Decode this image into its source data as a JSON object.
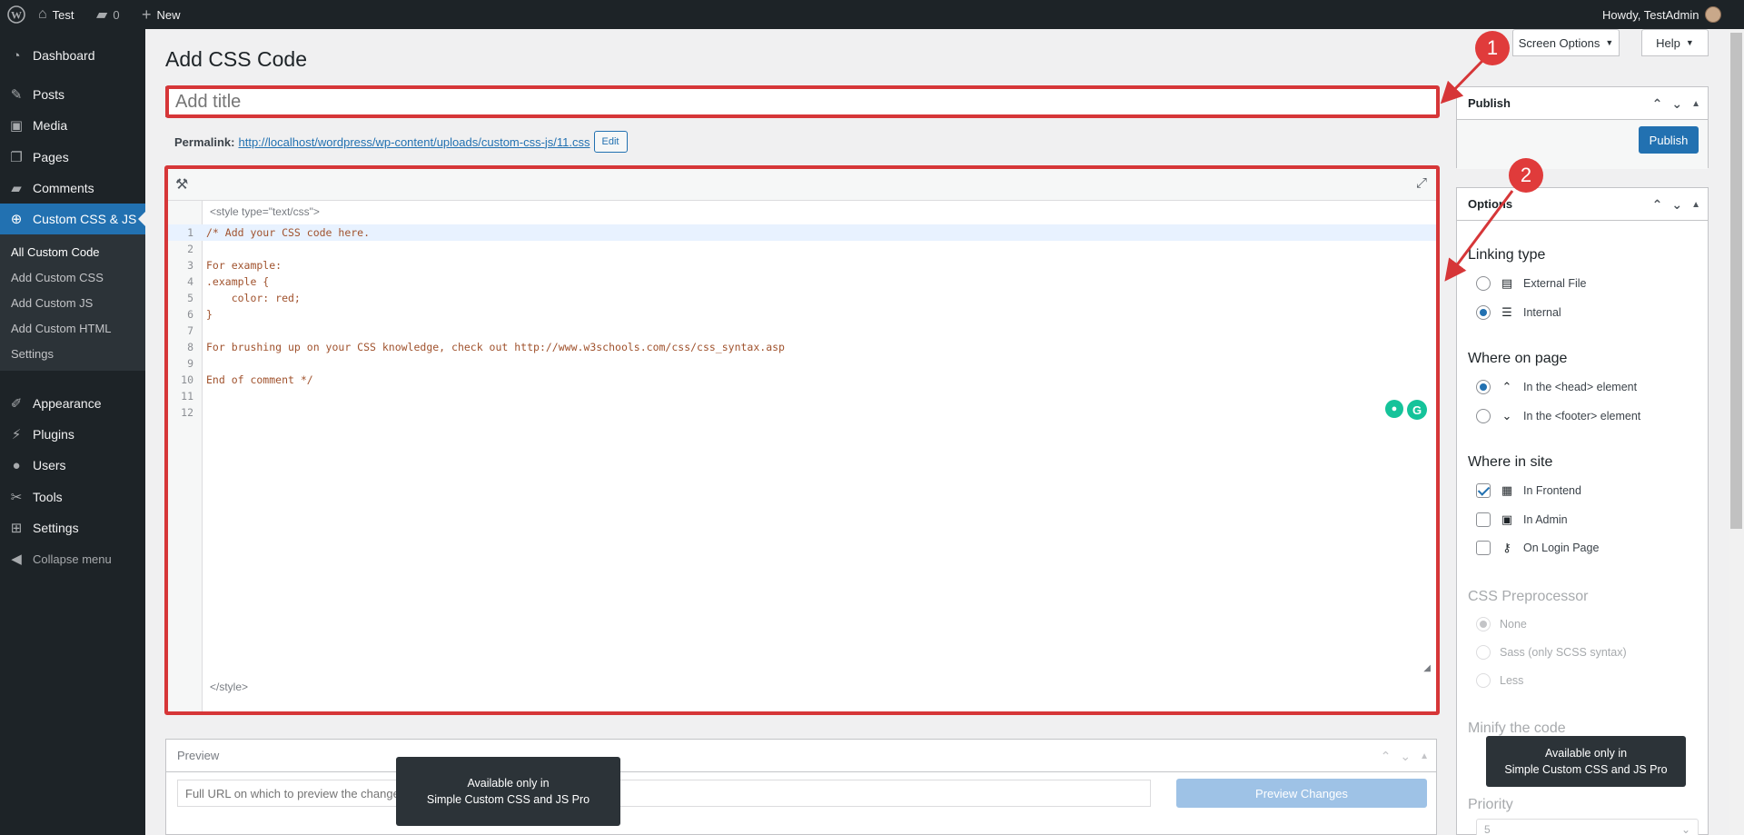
{
  "adminbar": {
    "site_name": "Test",
    "comments_count": "0",
    "new_label": "New",
    "greeting": "Howdy, TestAdmin"
  },
  "sidebar": {
    "items": [
      {
        "label": "Dashboard",
        "icon": "gauge-icon"
      },
      {
        "label": "Posts",
        "icon": "pin-icon"
      },
      {
        "label": "Media",
        "icon": "media-icon"
      },
      {
        "label": "Pages",
        "icon": "pages-icon"
      },
      {
        "label": "Comments",
        "icon": "comment-icon"
      },
      {
        "label": "Custom CSS & JS",
        "icon": "plus-circle-icon"
      },
      {
        "label": "Appearance",
        "icon": "brush-icon"
      },
      {
        "label": "Plugins",
        "icon": "plugin-icon"
      },
      {
        "label": "Users",
        "icon": "user-icon"
      },
      {
        "label": "Tools",
        "icon": "wrench-icon"
      },
      {
        "label": "Settings",
        "icon": "settings-icon"
      }
    ],
    "submenu": [
      "All Custom Code",
      "Add Custom CSS",
      "Add Custom JS",
      "Add Custom HTML",
      "Settings"
    ],
    "collapse_label": "Collapse menu"
  },
  "header": {
    "screen_options": "Screen Options",
    "help": "Help",
    "title": "Add CSS Code"
  },
  "title_input": {
    "placeholder": "Add title",
    "value": ""
  },
  "permalink": {
    "label": "Permalink:",
    "url": "http://localhost/wordpress/wp-content/uploads/custom-css-js/11.css",
    "edit_label": "Edit"
  },
  "editor": {
    "open_tag": "<style type=\"text/css\">",
    "close_tag": "</style>",
    "lines": [
      "/* Add your CSS code here.",
      "",
      "For example:",
      ".example {",
      "    color: red;",
      "}",
      "",
      "For brushing up on your CSS knowledge, check out http://www.w3schools.com/css/css_syntax.asp",
      "",
      "End of comment */",
      "",
      ""
    ]
  },
  "preview": {
    "title": "Preview",
    "url_placeholder": "Full URL on which to preview the changes",
    "button": "Preview Changes"
  },
  "publish": {
    "title": "Publish",
    "button": "Publish"
  },
  "options": {
    "title": "Options",
    "linking_type": {
      "heading": "Linking type",
      "options": [
        "External File",
        "Internal"
      ],
      "selected": 1
    },
    "where_on_page": {
      "heading": "Where on page",
      "options": [
        "In the <head> element",
        "In the <footer> element"
      ],
      "selected": 0
    },
    "where_in_site": {
      "heading": "Where in site",
      "options": [
        "In Frontend",
        "In Admin",
        "On Login Page"
      ],
      "checked": [
        true,
        false,
        false
      ]
    },
    "preprocessor": {
      "heading": "CSS Preprocessor",
      "options": [
        "None",
        "Sass (only SCSS syntax)",
        "Less"
      ],
      "selected": 0
    },
    "minify_heading": "Minify the code",
    "priority_heading": "Priority",
    "priority_value": "5"
  },
  "tooltip": {
    "line1": "Available only in",
    "line2": "Simple Custom CSS and JS Pro"
  },
  "annotations": [
    "1",
    "2"
  ],
  "colors": {
    "accent": "#2271b1",
    "annotation_red": "#d63638",
    "adminbar": "#1d2327"
  }
}
